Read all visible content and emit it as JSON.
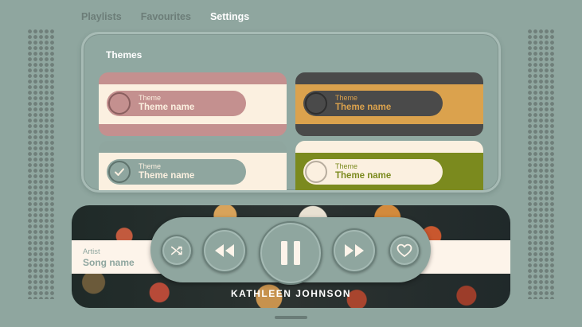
{
  "tabs": [
    {
      "label": "Playlists",
      "active": false
    },
    {
      "label": "Favourites",
      "active": false
    },
    {
      "label": "Settings",
      "active": true
    }
  ],
  "themes": {
    "title": "Themes",
    "cards": [
      {
        "sub_label": "Theme",
        "name": "Theme name",
        "selected": false,
        "colors": {
          "top": "#c4908f",
          "mid": "#fbf0e0",
          "bottom": "#c4908f",
          "pill": "#c4908f",
          "text": "#fbf0e0"
        }
      },
      {
        "sub_label": "Theme",
        "name": "Theme name",
        "selected": false,
        "colors": {
          "top": "#4a4a4a",
          "mid": "#dba24d",
          "bottom": "#4a4a4a",
          "pill": "#4a4a4a",
          "text": "#dba24d"
        }
      },
      {
        "sub_label": "Theme",
        "name": "Theme name",
        "selected": true,
        "colors": {
          "top": "#8fa69f",
          "mid": "#fbf0e0",
          "bottom": "#8fa69f",
          "pill": "#8fa69f",
          "text": "#fbf0e0"
        }
      },
      {
        "sub_label": "Theme",
        "name": "Theme name",
        "selected": false,
        "colors": {
          "top": "#fbf0e0",
          "mid": "#7b8a1e",
          "bottom": "#fbf0e0",
          "pill": "#fbf0e0",
          "text": "#7b8a1e"
        }
      }
    ]
  },
  "player": {
    "artist_label": "Artist",
    "song_label": "Song name",
    "album_text": "KATHLEEN JOHNSON"
  },
  "controls": {
    "shuffle": "shuffle-icon",
    "rewind": "rewind-icon",
    "pause": "pause-icon",
    "fast_forward": "fast-forward-icon",
    "favourite": "heart-icon"
  },
  "colors": {
    "background": "#8fa69f",
    "accent_light": "#fbf0e0",
    "icon": "#fdf4ea"
  }
}
